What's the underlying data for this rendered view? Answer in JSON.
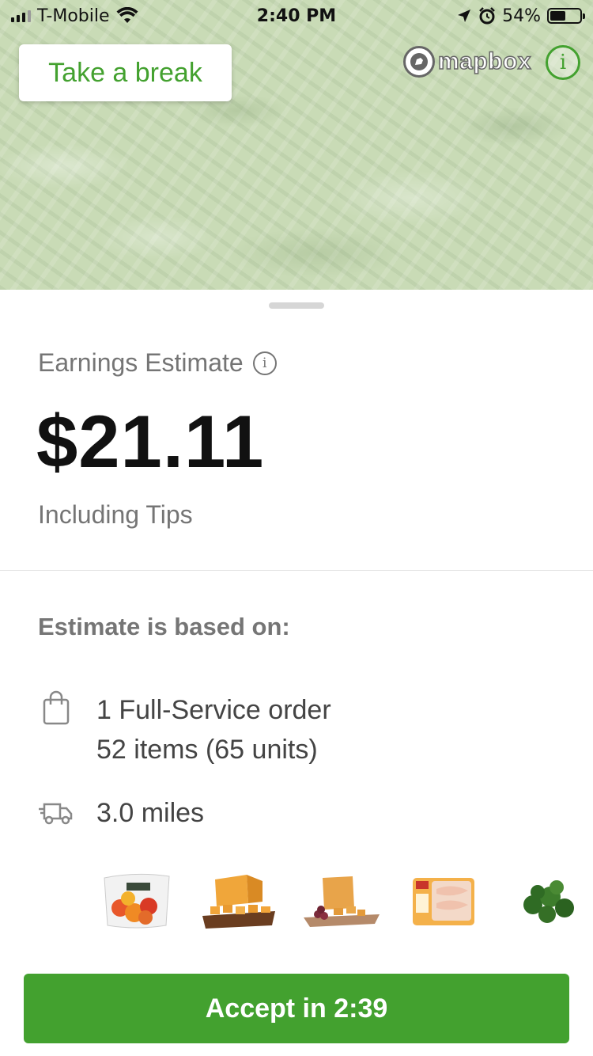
{
  "status_bar": {
    "carrier": "T-Mobile",
    "time": "2:40 PM",
    "battery_percent": "54%",
    "battery_level": 0.54,
    "icons": [
      "signal-icon",
      "wifi-icon",
      "location-arrow-icon",
      "alarm-icon",
      "battery-icon"
    ]
  },
  "map": {
    "break_button_label": "Take a break",
    "attribution_label": "mapbox",
    "info_glyph": "i"
  },
  "earnings": {
    "label": "Earnings Estimate",
    "info_glyph": "i",
    "amount": "$21.11",
    "note": "Including Tips"
  },
  "estimate": {
    "heading": "Estimate is based on:",
    "order_line1": "1 Full-Service order",
    "order_line2": "52 items (65 units)",
    "distance": "3.0 miles"
  },
  "products": [
    {
      "name": "bagged-peppers-image"
    },
    {
      "name": "cheddar-cheese-board-image"
    },
    {
      "name": "cheese-and-grapes-image"
    },
    {
      "name": "chicken-breast-package-image"
    },
    {
      "name": "brussels-sprouts-image"
    }
  ],
  "accept_button_label": "Accept in 2:39",
  "colors": {
    "brand_green": "#43a12f",
    "map_green": "#c9dbb6",
    "muted_text": "#757575"
  }
}
